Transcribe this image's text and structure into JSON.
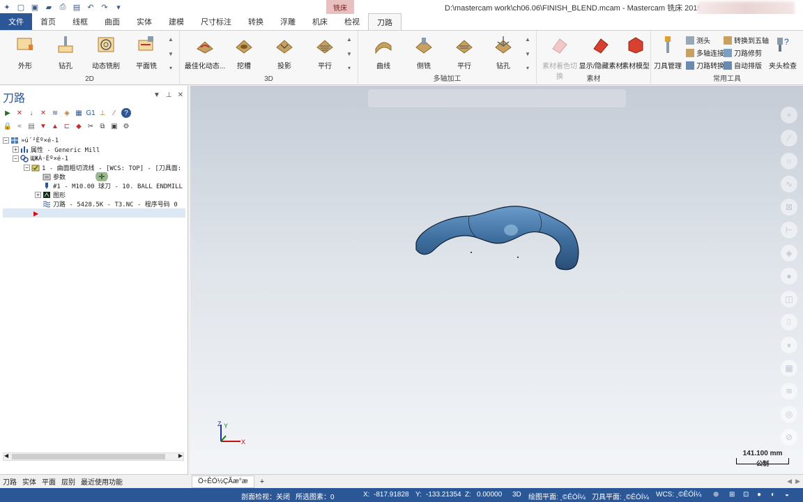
{
  "window": {
    "title": "D:\\mastercam work\\ch06.06\\FINISH_BLEND.mcam - Mastercam 铣床 2019",
    "context_tab": "铣床"
  },
  "ribbon_tabs": [
    "文件",
    "首页",
    "线框",
    "曲面",
    "实体",
    "建模",
    "尺寸标注",
    "转换",
    "浮雕",
    "机床",
    "检视",
    "刀路"
  ],
  "groups": {
    "g2d": {
      "label": "2D",
      "buttons": [
        "外形",
        "钻孔",
        "动态铣削",
        "平面铣"
      ]
    },
    "g3d": {
      "label": "3D",
      "buttons": [
        "最佳化动态...",
        "挖槽",
        "投影",
        "平行"
      ]
    },
    "gmulti": {
      "label": "多轴加工",
      "buttons": [
        "曲线",
        "侧铣",
        "平行",
        "钻孔"
      ]
    },
    "gstock": {
      "label": "素材",
      "buttons": [
        "素材着色切换",
        "显示/隐藏素材",
        "素材模型"
      ]
    },
    "gtools": {
      "label": "常用工具",
      "big": "刀具管理",
      "small": [
        "测头",
        "多轴连接",
        "刀路转换",
        "转换到五轴",
        "刀路修剪",
        "自动排版"
      ],
      "check": "夹头检查"
    }
  },
  "panel": {
    "title": "刀路",
    "tree": [
      {
        "indent": 0,
        "exp": "-",
        "icon": "machine-group-icon",
        "text": "»ú´²Èº×é-1"
      },
      {
        "indent": 1,
        "exp": "+",
        "icon": "properties-icon",
        "text": "属性 - Generic Mill"
      },
      {
        "indent": 1,
        "exp": "-",
        "icon": "toolpath-group-icon",
        "text": "ЩЖÀ·Èº×é-1"
      },
      {
        "indent": 2,
        "exp": "-",
        "icon": "operation-icon",
        "text": "1 - 曲面粗切流线 - [WCS: TOP] - [刀具面:"
      },
      {
        "indent": 3,
        "exp": "",
        "icon": "folder-icon",
        "text": "参数"
      },
      {
        "indent": 3,
        "exp": "",
        "icon": "tool-icon",
        "text": "#1 - M10.00 球刀 -   10. BALL ENDMILL"
      },
      {
        "indent": 3,
        "exp": "+",
        "icon": "geometry-icon",
        "text": "图形"
      },
      {
        "indent": 3,
        "exp": "",
        "icon": "path-icon",
        "text": "刀路 - 5428.5K - T3.NC - 程序号码 0"
      }
    ]
  },
  "bottom_tabs": [
    "刀路",
    "实体",
    "平面",
    "层别",
    "最近使用功能"
  ],
  "doc_tab": "Ö÷ÊÓ½ÇÃæ°æ",
  "scale": {
    "value": "141.100 mm",
    "unit": "公制"
  },
  "status": {
    "section_view": "剖面检视：关闭",
    "selected": "所选图素：0",
    "x_label": "X:",
    "x": "-817.91828",
    "y_label": "Y:",
    "y": "-133.21354",
    "z_label": "Z:",
    "z": "0.00000",
    "mode": "3D",
    "cplane": "绘图平面: ¸©ÊÓÍ¼",
    "tplane": "刀具平面: ¸©ÊÓÍ¼",
    "wcs": "WCS: ¸©ÊÓÍ¼"
  },
  "colors": {
    "accent": "#2b5797",
    "part": "#4a7fb5",
    "active_tab": "#e8c0c0"
  }
}
